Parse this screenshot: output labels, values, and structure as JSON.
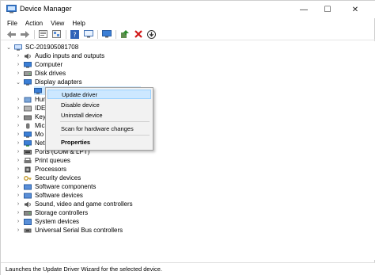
{
  "window": {
    "title": "Device Manager",
    "controls": {
      "minimize": "—",
      "maximize": "☐",
      "close": "✕"
    }
  },
  "menubar": [
    "File",
    "Action",
    "View",
    "Help"
  ],
  "toolbar": [
    "back-icon",
    "forward-icon",
    "properties-icon",
    "show-hidden-icon",
    "help-icon",
    "computer-icon",
    "monitor-icon",
    "update-driver-icon",
    "uninstall-icon",
    "download-icon"
  ],
  "tree": {
    "root": "SC-201905081708",
    "items": [
      {
        "label": "Audio inputs and outputs",
        "expanded": false
      },
      {
        "label": "Computer",
        "expanded": false
      },
      {
        "label": "Disk drives",
        "expanded": false
      },
      {
        "label": "Display adapters",
        "expanded": true
      },
      {
        "label": "",
        "child": true
      },
      {
        "label": "Hum",
        "expanded": false
      },
      {
        "label": "IDE",
        "expanded": false
      },
      {
        "label": "Key",
        "expanded": false
      },
      {
        "label": "Mic",
        "expanded": false
      },
      {
        "label": "Mo",
        "expanded": false
      },
      {
        "label": "Net",
        "expanded": false
      },
      {
        "label": "Ports (COM & LPT)",
        "expanded": false
      },
      {
        "label": "Print queues",
        "expanded": false
      },
      {
        "label": "Processors",
        "expanded": false
      },
      {
        "label": "Security devices",
        "expanded": false
      },
      {
        "label": "Software components",
        "expanded": false
      },
      {
        "label": "Software devices",
        "expanded": false
      },
      {
        "label": "Sound, video and game controllers",
        "expanded": false
      },
      {
        "label": "Storage controllers",
        "expanded": false
      },
      {
        "label": "System devices",
        "expanded": false
      },
      {
        "label": "Universal Serial Bus controllers",
        "expanded": false
      }
    ]
  },
  "context_menu": {
    "items": [
      "Update driver",
      "Disable device",
      "Uninstall device",
      "Scan for hardware changes",
      "Properties"
    ],
    "highlighted": "Update driver"
  },
  "statusbar": "Launches the Update Driver Wizard for the selected device."
}
